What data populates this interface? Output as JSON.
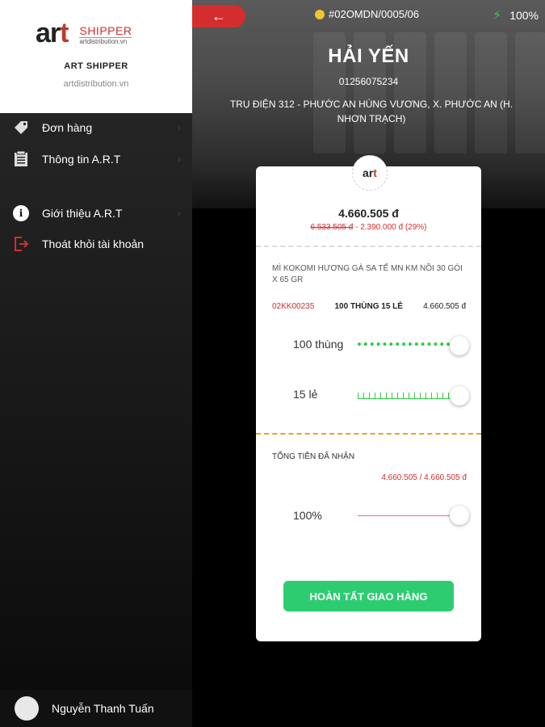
{
  "header": {
    "back_icon": "arrow-left-icon",
    "order_code": "#02OMDN/0005/06",
    "battery_text": "100%"
  },
  "customer": {
    "name": "HẢI YẾN",
    "phone": "01256075234",
    "address": "TRỤ ĐIỆN 312 - PHƯỚC AN HÙNG VƯƠNG, X. PHƯỚC AN (H. NHƠN TRẠCH)"
  },
  "card": {
    "logo_a": "a",
    "logo_r": "r",
    "logo_t": "t",
    "total": "4.660.505 đ",
    "old_price": "6.533.505 đ",
    "discount": " - 2.390.000 đ (29%)",
    "product_name": "MÌ KOKOMI HƯƠNG GÀ SA TẾ MN KM NỒI 30 GÓI X 65 GR",
    "product_code": "02KK00235",
    "product_qty": "100 THÙNG 15 LẺ",
    "product_amount": "4.660.505 đ",
    "slider_boxes_label": "100 thùng",
    "slider_units_label": "15 lẻ",
    "received_label": "TỔNG TIỀN ĐÃ NHẬN",
    "received_value": "4.660.505 / 4.660.505 đ",
    "percent_label": "100%",
    "percent_value": 1.0,
    "done_button": "HOÀN TẤT GIAO HÀNG"
  },
  "sidebar": {
    "logo_a": "a",
    "logo_r": "r",
    "logo_t": "t",
    "logo_shipper": "SHIPPER",
    "logo_url": "artdistribution.vn",
    "title": "ART SHIPPER",
    "url": "artdistribution.vn",
    "items": [
      {
        "label": "Đơn hàng",
        "icon": "tag-icon"
      },
      {
        "label": "Thông tin A.R.T",
        "icon": "document-icon"
      },
      {
        "label": "Giới thiệu A.R.T",
        "icon": "info-icon"
      },
      {
        "label": "Thoát khỏi tài khoản",
        "icon": "logout-icon"
      }
    ],
    "user_name": "Nguyễn Thanh Tuấn"
  },
  "colors": {
    "accent_red": "#d42d2d",
    "accent_green": "#2ecc71",
    "accent_orange": "#f0a020"
  }
}
